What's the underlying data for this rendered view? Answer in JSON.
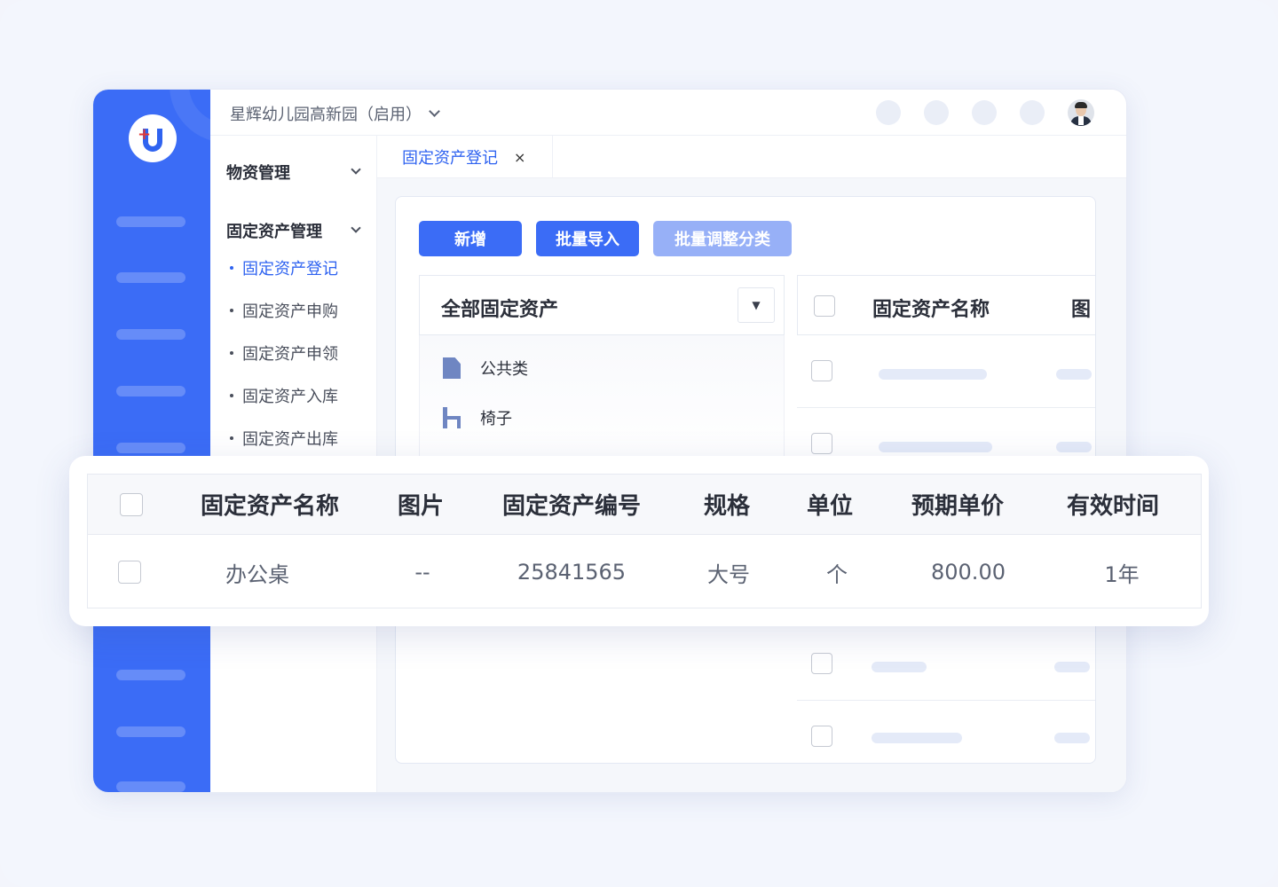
{
  "topbar": {
    "org_name": "星辉幼儿园高新园（启用）"
  },
  "sidebar": {
    "groups": [
      {
        "label": "物资管理"
      },
      {
        "label": "固定资产管理"
      }
    ],
    "items": [
      {
        "label": "固定资产登记",
        "active": true
      },
      {
        "label": "固定资产申购"
      },
      {
        "label": "固定资产申领"
      },
      {
        "label": "固定资产入库"
      },
      {
        "label": "固定资产出库"
      }
    ]
  },
  "tabs": [
    {
      "label": "固定资产登记",
      "close": "×"
    }
  ],
  "toolbar": {
    "add_label": "新增",
    "import_label": "批量导入",
    "reclassify_label": "批量调整分类"
  },
  "tree": {
    "title": "全部固定资产",
    "select_arrow": "▼",
    "nodes": [
      {
        "label": "公共类",
        "icon": "document-icon"
      },
      {
        "label": "椅子",
        "icon": "chair-icon"
      }
    ]
  },
  "grid": {
    "header_name": "固定资产名称",
    "header_cut": "图"
  },
  "table": {
    "columns": [
      "固定资产名称",
      "图片",
      "固定资产编号",
      "规格",
      "单位",
      "预期单价",
      "有效时间"
    ],
    "rows": [
      [
        "办公桌",
        "--",
        "25841565",
        "大号",
        "个",
        "800.00",
        "1年"
      ]
    ]
  },
  "colors": {
    "primary": "#3b6cf6",
    "primary_disabled": "#97b0f7",
    "rail": "#3b6cf6",
    "active_text": "#2f63f0"
  }
}
